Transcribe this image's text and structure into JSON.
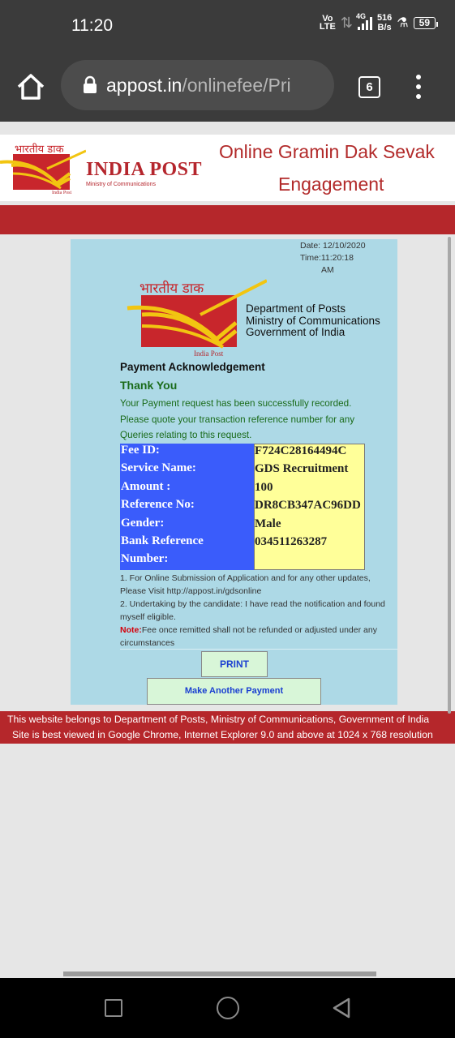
{
  "status_bar": {
    "time": "11:20",
    "volte_line1": "Vo",
    "volte_line2": "LTE",
    "network": "4G",
    "speed_value": "516",
    "speed_unit": "B/s",
    "battery": "59"
  },
  "browser": {
    "url_host": "appost.in",
    "url_path": "/onlinefee/Pri",
    "tab_count": "6"
  },
  "header": {
    "hindi_logo_text": "भारतीय डाक",
    "brand": "INDIA POST",
    "ministry": "Ministry of Communications",
    "small_caption": "India Post",
    "title_line1": "Online Gramin Dak Sevak",
    "title_line2": "Engagement"
  },
  "receipt": {
    "date": "Date: 12/10/2020",
    "time": "Time:11:20:18",
    "ampm": "AM",
    "logo_hindi": "भारतीय डाक",
    "logo_caption": "India Post",
    "dept_line1": "Department of Posts",
    "dept_line2": "Ministry of Communications",
    "dept_line3": "Government of India",
    "title": "Payment Acknowledgement",
    "thanks": "Thank You",
    "message_line1": "Your Payment request has been successfully recorded.",
    "message_line2": "Please quote your transaction reference number for any",
    "message_line3": "Queries relating to this request.",
    "fields": [
      {
        "label": "Fee ID:",
        "value": "F724C28164494C"
      },
      {
        "label": "Service Name:",
        "value": "GDS Recruitment"
      },
      {
        "label": "Amount :",
        "value": "100"
      },
      {
        "label": "Reference No:",
        "value": "DR8CB347AC96DD"
      },
      {
        "label": "Gender:",
        "value": "Male"
      },
      {
        "label": "Bank Reference",
        "value": "034511263287"
      }
    ],
    "bank_ref_label_line2": "Number:",
    "note1_line1": "1. For Online Submission of Application and for any other updates,",
    "note1_line2": "Please Visit http://appost.in/gdsonline",
    "note2_line1": "2. Undertaking by the candidate: I have read the notification and found",
    "note2_line2": "myself eligible.",
    "note_label": "Note:",
    "note_text_line1": "Fee once remitted shall not be refunded or adjusted under any",
    "note_text_line2": "circumstances",
    "print_label": "PRINT",
    "another_label": "Make Another Payment"
  },
  "footer": {
    "line1": "This website belongs to Department of Posts, Ministry of Communications, Government of India",
    "line2": "Site is best viewed in Google Chrome, Internet Explorer 9.0 and above at 1024 x 768 resolution"
  },
  "icons": {
    "home": "home-icon",
    "lock": "lock-icon",
    "menu": "more-vert-icon",
    "recent": "recent-apps-icon",
    "nav_home": "nav-home-icon",
    "back": "back-icon"
  },
  "colors": {
    "brand_red": "#b5272b",
    "card_bg": "#add9e6",
    "label_blue": "#3a5cfb",
    "value_yellow": "#ffff99",
    "success_green": "#1a6b1a"
  }
}
